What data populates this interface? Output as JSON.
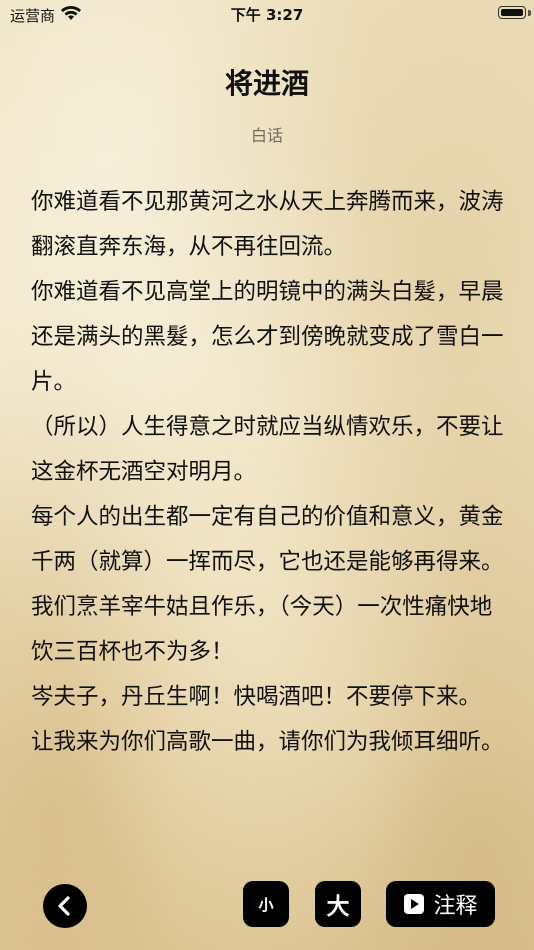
{
  "status_bar": {
    "carrier": "运营商",
    "time": "下午 3:27"
  },
  "poem": {
    "title": "将进酒",
    "mode_label": "白话",
    "paragraphs": [
      "你难道看不见那黄河之水从天上奔腾而来，波涛翻滚直奔东海，从不再往回流。",
      "你难道看不见高堂上的明镜中的满头白髮，早晨还是满头的黑髮，怎么才到傍晚就变成了雪白一片。",
      "（所以）人生得意之时就应当纵情欢乐，不要让这金杯无酒空对明月。",
      "每个人的出生都一定有自己的价值和意义，黄金千两（就算）一挥而尽，它也还是能够再得来。",
      "我们烹羊宰牛姑且作乐，（今天）一次性痛快地饮三百杯也不为多！",
      "岑夫子，丹丘生啊！快喝酒吧！不要停下来。",
      "让我来为你们高歌一曲，请你们为我倾耳细听。"
    ]
  },
  "toolbar": {
    "back_icon": "chevron-left-icon",
    "small_label": "小",
    "large_label": "大",
    "note_icon": "play-square-icon",
    "note_label": "注释"
  }
}
